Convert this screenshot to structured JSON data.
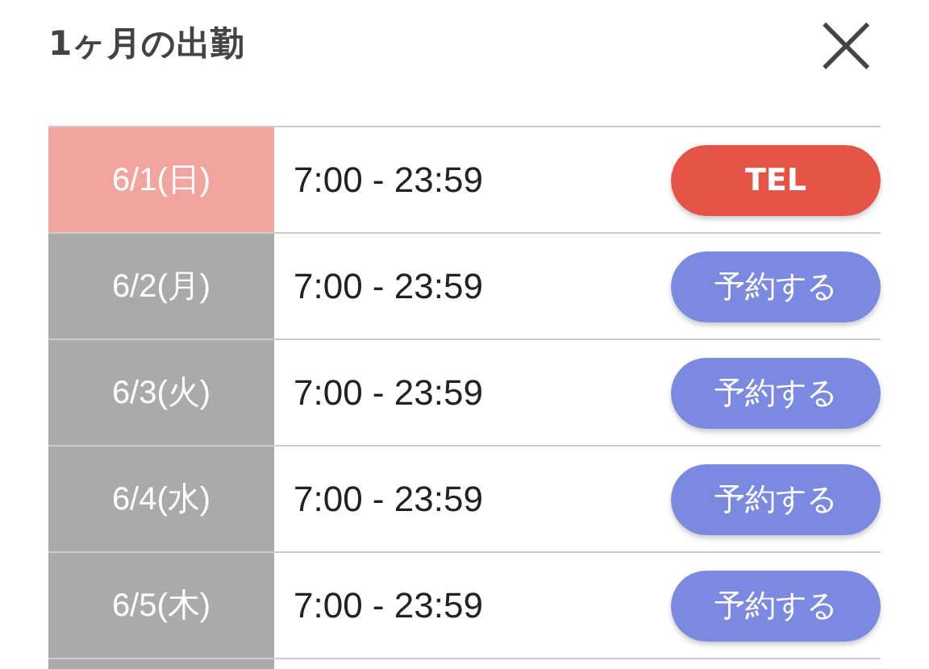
{
  "title": "1ヶ月の出勤",
  "close_button": {
    "label": "×"
  },
  "schedule": [
    {
      "date": "6/1(日)",
      "time": "7:00 - 23:59",
      "kind": "sunday",
      "action": "TEL"
    },
    {
      "date": "6/2(月)",
      "time": "7:00 - 23:59",
      "kind": "weekday",
      "action": "予約する"
    },
    {
      "date": "6/3(火)",
      "time": "7:00 - 23:59",
      "kind": "weekday",
      "action": "予約する"
    },
    {
      "date": "6/4(水)",
      "time": "7:00 - 23:59",
      "kind": "weekday",
      "action": "予約する"
    },
    {
      "date": "6/5(木)",
      "time": "7:00 - 23:59",
      "kind": "weekday",
      "action": "予約する"
    }
  ]
}
